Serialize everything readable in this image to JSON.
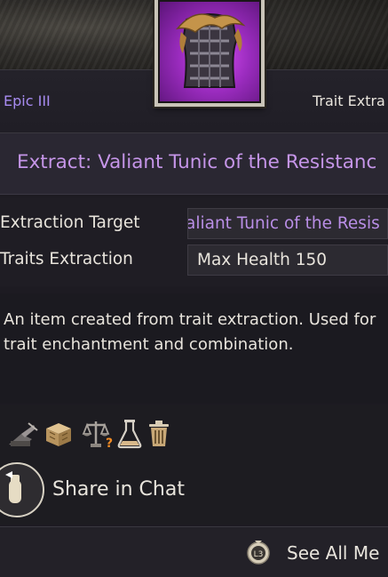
{
  "item": {
    "grade": "Epic III",
    "category_label": "Trait Extra",
    "title": "Extract: Valiant Tunic of the Resistanc"
  },
  "details": {
    "rows": [
      {
        "label": "Extraction Target",
        "value": "aliant Tunic of the Resis"
      },
      {
        "label": "Traits Extraction",
        "value": "Max Health 150"
      }
    ]
  },
  "description": "An item created from trait extraction. Used for trait enchantment and combination.",
  "actions": {
    "icons": [
      "gathering-icon",
      "storage-box-icon",
      "trade-scale-icon",
      "alchemy-flask-icon",
      "trash-icon"
    ]
  },
  "share": {
    "label": "Share in Chat"
  },
  "footer": {
    "key_hint": "L3",
    "label": "See All Me"
  },
  "colors": {
    "epic_purple": "#c595e8",
    "grade_text": "#a78bf0",
    "icon_gold": "#c8a877"
  }
}
